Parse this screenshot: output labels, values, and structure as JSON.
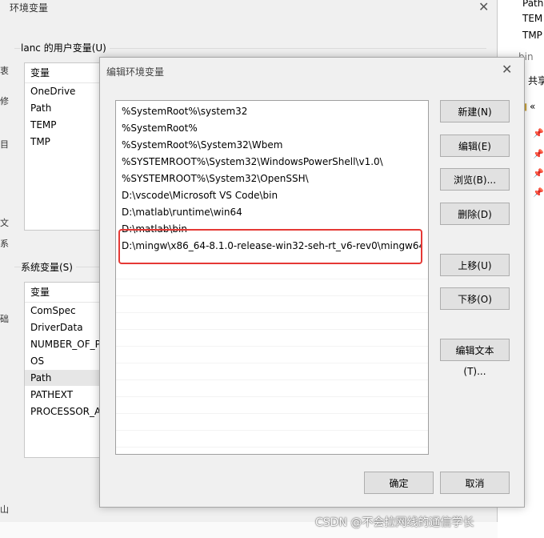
{
  "env_window": {
    "title": "环境变量",
    "user_group_label": "lanc 的用户变量(U)",
    "user_table": {
      "header": "变量",
      "rows": [
        "OneDrive",
        "Path",
        "TEMP",
        "TMP"
      ]
    },
    "system_group_label": "系统变量(S)",
    "system_table": {
      "header": "变量",
      "rows": [
        "ComSpec",
        "DriverData",
        "NUMBER_OF_P",
        "OS",
        "Path",
        "PATHEXT",
        "PROCESSOR_AI"
      ],
      "selected_index": 4
    },
    "edge_letters": [
      "衷",
      "修",
      "目",
      "文",
      "系",
      "础",
      "山"
    ]
  },
  "right_panel": {
    "items": [
      "Path",
      "TEM",
      "TMP"
    ],
    "path_bar": "bin",
    "share_label": "共享",
    "folder_label": "«"
  },
  "edit_dialog": {
    "title": "编辑环境变量",
    "entries": [
      "%SystemRoot%\\system32",
      "%SystemRoot%",
      "%SystemRoot%\\System32\\Wbem",
      "%SYSTEMROOT%\\System32\\WindowsPowerShell\\v1.0\\",
      "%SYSTEMROOT%\\System32\\OpenSSH\\",
      "D:\\vscode\\Microsoft VS Code\\bin",
      "D:\\matlab\\runtime\\win64",
      "D:\\matlab\\bin",
      "D:\\mingw\\x86_64-8.1.0-release-win32-seh-rt_v6-rev0\\mingw64\\..."
    ],
    "buttons": {
      "new": "新建(N)",
      "edit": "编辑(E)",
      "browse": "浏览(B)...",
      "delete": "删除(D)",
      "move_up": "上移(U)",
      "move_down": "下移(O)",
      "edit_text": "编辑文本(T)...",
      "ok": "确定",
      "cancel": "取消"
    },
    "highlight_color": "#e53935"
  },
  "watermark": "CSDN @不会拉网线的通信学长"
}
